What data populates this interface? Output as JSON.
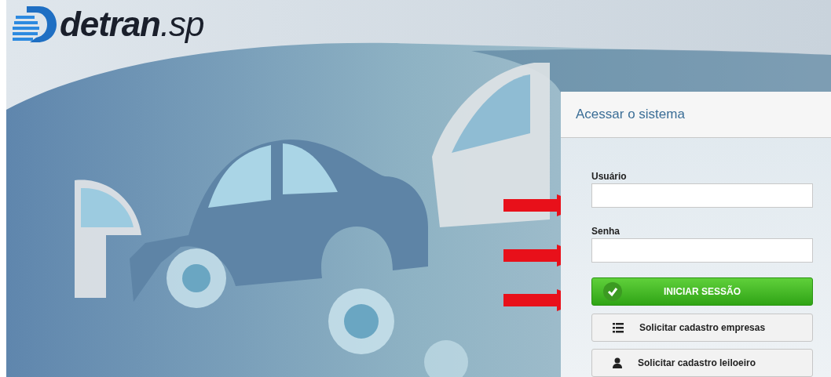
{
  "logo": {
    "text": "**detran**.sp"
  },
  "login_panel": {
    "title": "Acessar o sistema",
    "fields": [
      {
        "label": "Usuário"
      },
      {
        "label": "Senha"
      }
    ],
    "submit": {
      "label": "INICIAR SESSÃO"
    },
    "links": [
      {
        "label": "Solicitar cadastro empresas",
        "kind": "list"
      },
      {
        "label": "Solicitar cadastro leiloeiro",
        "kind": "person"
      }
    ]
  }
}
